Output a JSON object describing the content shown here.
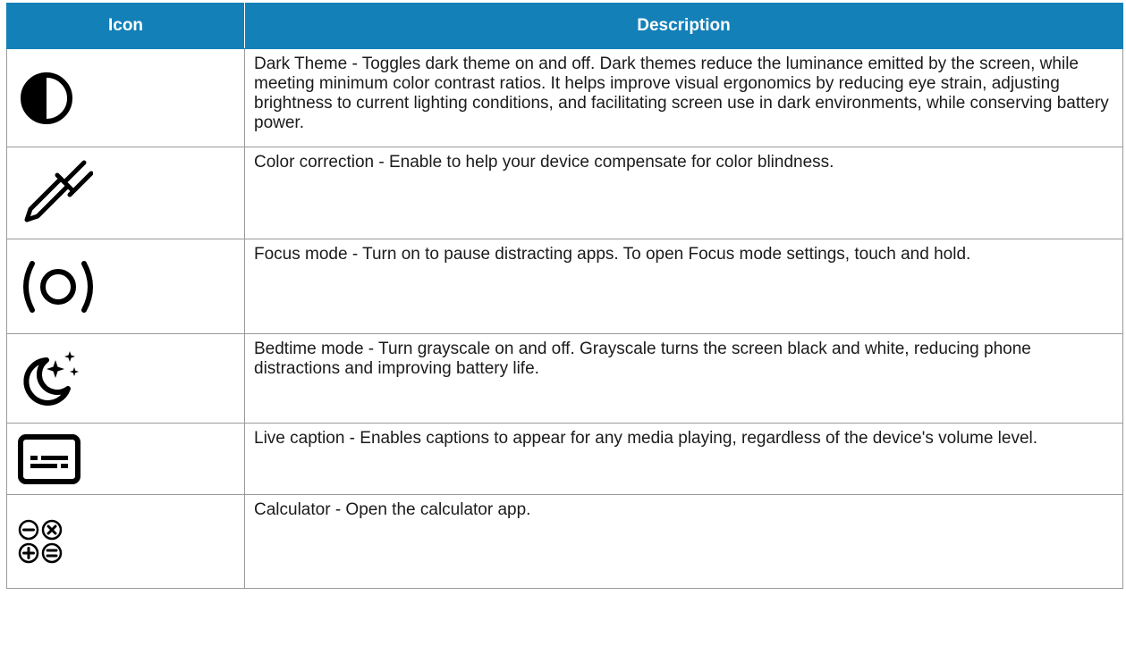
{
  "header": {
    "icon_col": "Icon",
    "desc_col": "Description"
  },
  "rows": [
    {
      "icon": "dark-theme-icon",
      "description": "Dark Theme - Toggles dark theme on and off. Dark themes reduce the luminance emitted by the screen, while meeting minimum color contrast ratios. It helps improve visual ergonomics by reducing eye strain, adjusting brightness to current lighting conditions, and facilitating screen use in dark environments, while conserving battery power."
    },
    {
      "icon": "eyedropper-icon",
      "description": "Color correction - Enable to help your device compensate for color blindness."
    },
    {
      "icon": "focus-mode-icon",
      "description": "Focus mode - Turn on to pause distracting apps. To open Focus mode settings, touch and hold."
    },
    {
      "icon": "bedtime-moon-icon",
      "description": "Bedtime mode - Turn grayscale on and off. Grayscale turns the screen black and white, reducing phone distractions and improving battery life."
    },
    {
      "icon": "live-caption-icon",
      "description": "Live caption -  Enables captions to appear for any media playing, regardless of the device's volume level."
    },
    {
      "icon": "calculator-icon",
      "description": "Calculator - Open the calculator app."
    }
  ],
  "colors": {
    "header_bg": "#1380b8",
    "header_text": "#ffffff",
    "border": "#9a9a9a"
  }
}
